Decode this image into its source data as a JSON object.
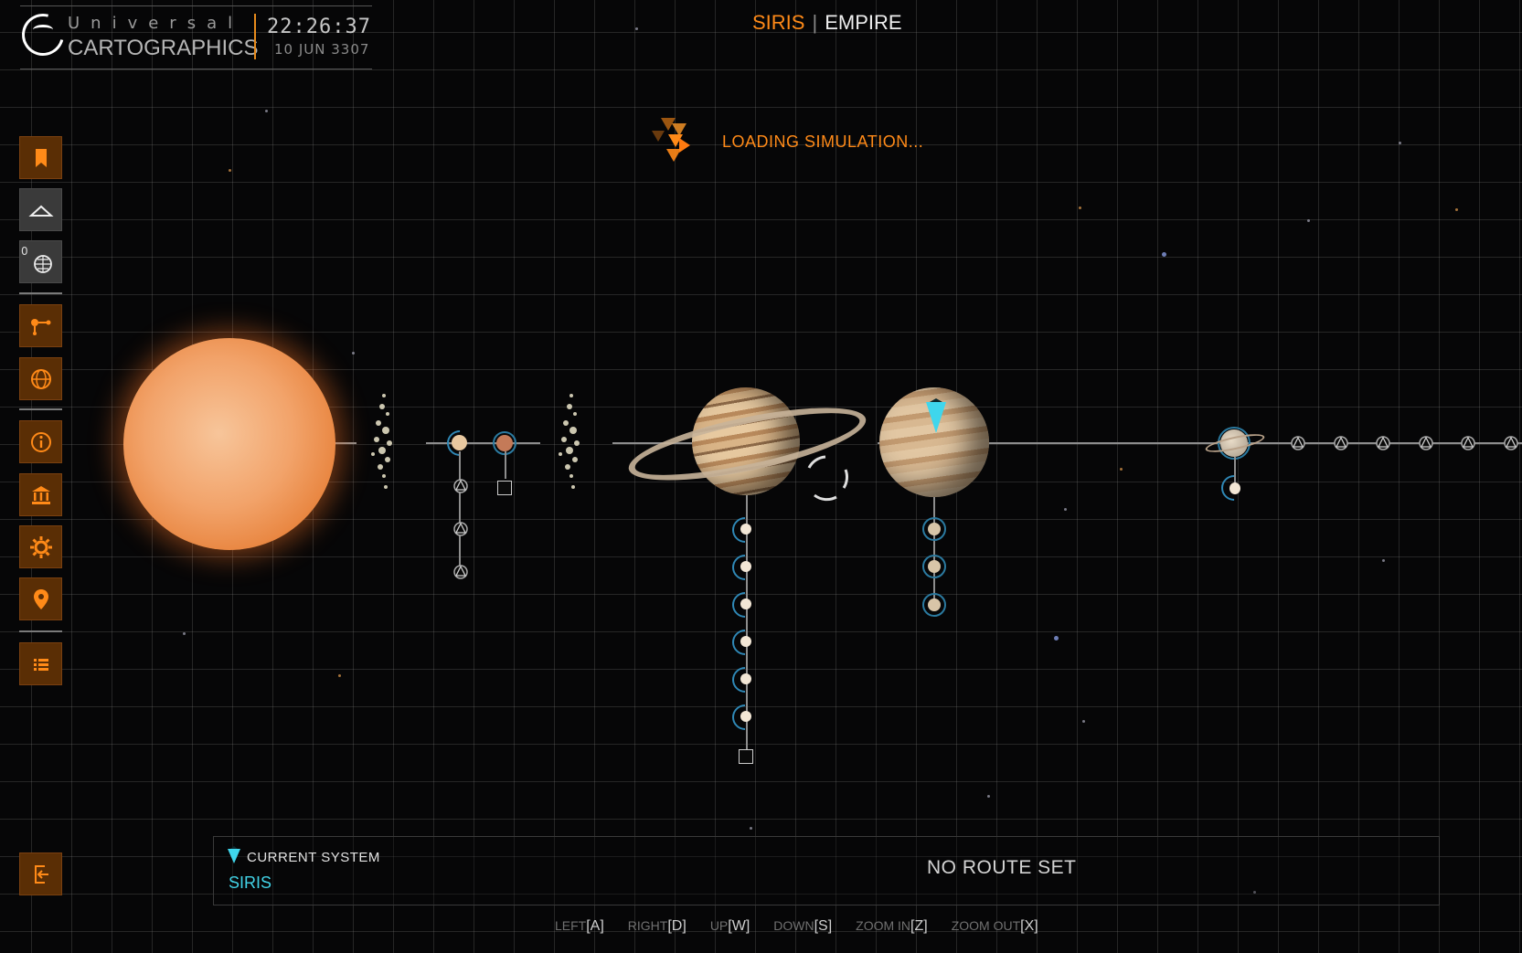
{
  "header": {
    "brand_top": "Universal",
    "brand_bottom": "CARTOGRAPHICS",
    "time": "22:26:37",
    "date": "10 JUN 3307"
  },
  "system_title": {
    "name": "SIRIS",
    "separator": "|",
    "allegiance": "EMPIRE"
  },
  "loading_text": "LOADING SIMULATION...",
  "sidebar": {
    "badge": "0",
    "items": [
      {
        "name": "bookmark",
        "icon": "bookmark-icon"
      },
      {
        "name": "orrery-view",
        "icon": "ship-view-icon"
      },
      {
        "name": "surface-scan",
        "icon": "globe-grid-icon"
      },
      {
        "name": "route",
        "icon": "route-icon"
      },
      {
        "name": "galaxy-map",
        "icon": "globe-icon"
      },
      {
        "name": "info",
        "icon": "info-icon"
      },
      {
        "name": "faction",
        "icon": "bank-icon"
      },
      {
        "name": "settings",
        "icon": "gear-icon"
      },
      {
        "name": "location",
        "icon": "location-pin-icon"
      },
      {
        "name": "list",
        "icon": "list-icon"
      }
    ],
    "exit_icon": "exit-icon"
  },
  "bottom_panel": {
    "current_system_label": "CURRENT SYSTEM",
    "current_system_name": "SIRIS",
    "route_status": "NO ROUTE SET"
  },
  "controls": [
    {
      "label": "LEFT",
      "key": "[A]"
    },
    {
      "label": "RIGHT",
      "key": "[D]"
    },
    {
      "label": "UP",
      "key": "[W]"
    },
    {
      "label": "DOWN",
      "key": "[S]"
    },
    {
      "label": "ZOOM IN",
      "key": "[Z]"
    },
    {
      "label": "ZOOM OUT",
      "key": "[X]"
    }
  ],
  "colors": {
    "accent": "#ff8a18",
    "current_system": "#42d4e8",
    "button_bg": "#5a2e05"
  }
}
